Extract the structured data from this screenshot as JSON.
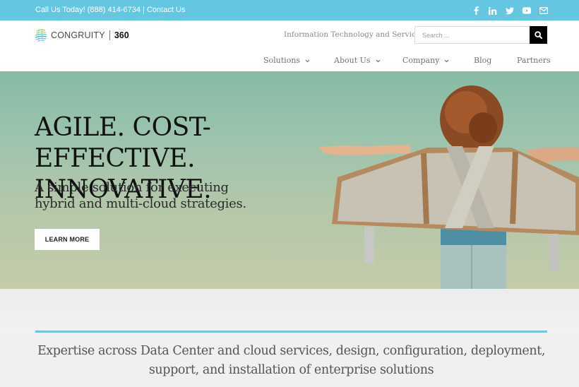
{
  "topbar": {
    "contact_prefix": "Call Us Today! (888) 414-6734 | ",
    "contact_link": "Contact Us",
    "social": [
      {
        "icon": "facebook-icon"
      },
      {
        "icon": "linkedin-icon"
      },
      {
        "icon": "twitter-icon"
      },
      {
        "icon": "youtube-icon"
      },
      {
        "icon": "email-icon"
      }
    ],
    "background_color": "#65c6e1"
  },
  "header": {
    "logo_word": "CONGRUITY",
    "logo_number": "360",
    "tagline": "Information Technology and Services",
    "search": {
      "placeholder": "Search ...",
      "value": "",
      "button_icon": "search-icon"
    }
  },
  "nav": {
    "items": [
      {
        "label": "Solutions",
        "has_dropdown": true
      },
      {
        "label": "About Us",
        "has_dropdown": true
      },
      {
        "label": "Company",
        "has_dropdown": true
      },
      {
        "label": "Blog",
        "has_dropdown": false
      },
      {
        "label": "Partners",
        "has_dropdown": false
      }
    ]
  },
  "hero": {
    "headline_line1": "AGILE. COST-EFFECTIVE.",
    "headline_line2": "INNOVATIVE.",
    "sub_line1": "A simple solution for executing",
    "sub_line2": "hybrid and multi-cloud strategies.",
    "cta_label": "LEARN MORE",
    "image_description": "child with cardboard airplane wings against sky"
  },
  "expertise": {
    "line1": "Expertise across Data Center and cloud services, design, configuration, deployment,",
    "line2": "support, and installation of enterprise solutions",
    "accent_color": "#7ac3dd"
  }
}
